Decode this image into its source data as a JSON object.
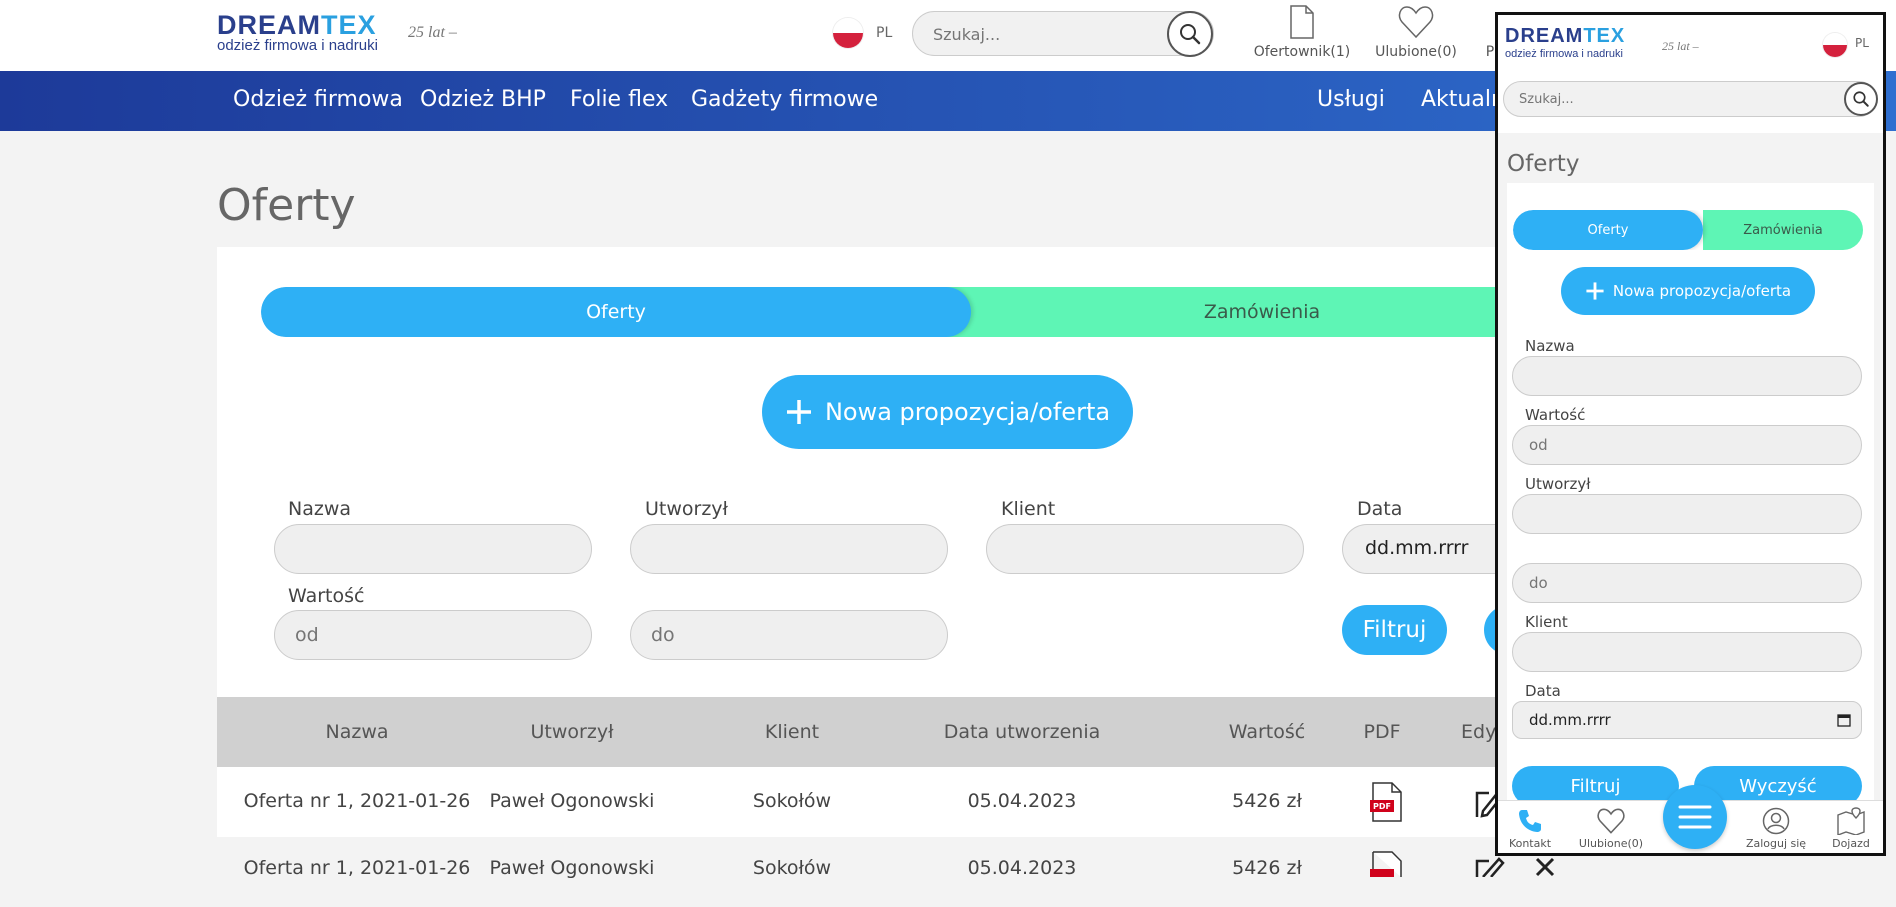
{
  "header": {
    "logo_dream": "DREAM",
    "logo_tex": "TEX",
    "logo_sub": "odzież firmowa i nadruki",
    "logo_years": "25 lat –",
    "lang": "PL",
    "search_placeholder": "Szukaj...",
    "icons": [
      {
        "icon": "document-icon",
        "label": "Ofertownik(1)"
      },
      {
        "icon": "heart-icon",
        "label": "Ulubione(0)"
      },
      {
        "icon": "user-icon",
        "label": "P"
      }
    ]
  },
  "nav": {
    "left": [
      "Odzież firmowa",
      "Odzież BHP",
      "Folie flex",
      "Gadżety firmowe"
    ],
    "right": [
      "Usługi",
      "Aktualn"
    ]
  },
  "page": {
    "title": "Oferty",
    "tab_offers": "Oferty",
    "tab_orders": "Zamówienia",
    "new_button": "Nowa propozycja/oferta",
    "filters": {
      "nazwa_label": "Nazwa",
      "utworzyl_label": "Utworzył",
      "klient_label": "Klient",
      "data_label": "Data",
      "data_value": "dd.mm.rrrr",
      "wartosc_label": "Wartość",
      "od_placeholder": "od",
      "do_placeholder": "do",
      "filter_button": "Filtruj"
    },
    "table": {
      "headers": [
        "Nazwa",
        "Utworzył",
        "Klient",
        "Data utworzenia",
        "Wartość",
        "PDF",
        "Edy"
      ],
      "rows": [
        {
          "nazwa": "Oferta nr 1, 2021-01-26",
          "utworzyl": "Paweł Ogonowski",
          "klient": "Sokołów",
          "data": "05.04.2023",
          "wartosc": "5426 zł"
        },
        {
          "nazwa": "Oferta nr 1, 2021-01-26",
          "utworzyl": "Paweł Ogonowski",
          "klient": "Sokołów",
          "data": "05.04.2023",
          "wartosc": "5426 zł"
        }
      ],
      "pdf_badge": "PDF"
    }
  },
  "mobile": {
    "lang": "PL",
    "search_placeholder": "Szukaj...",
    "title": "Oferty",
    "tab_offers": "Oferty",
    "tab_orders": "Zamówienia",
    "new_button": "Nowa propozycja/oferta",
    "nazwa_label": "Nazwa",
    "wartosc_label": "Wartość",
    "od_placeholder": "od",
    "utworzyl_label": "Utworzył",
    "do_placeholder": "do",
    "klient_label": "Klient",
    "data_label": "Data",
    "data_value": "dd.mm.rrrr",
    "filter_button": "Filtruj",
    "clear_button": "Wyczyść",
    "bottom": {
      "kontakt": "Kontakt",
      "ulubione": "Ulubione(0)",
      "zaloguj": "Zaloguj się",
      "dojazd": "Dojazd"
    }
  },
  "colors": {
    "accent_blue": "#2eb0f5",
    "accent_green": "#5ef5b5",
    "nav_dark": "#1d3a99",
    "nav_light": "#2f6fd0",
    "pdf_red": "#d0021b"
  }
}
